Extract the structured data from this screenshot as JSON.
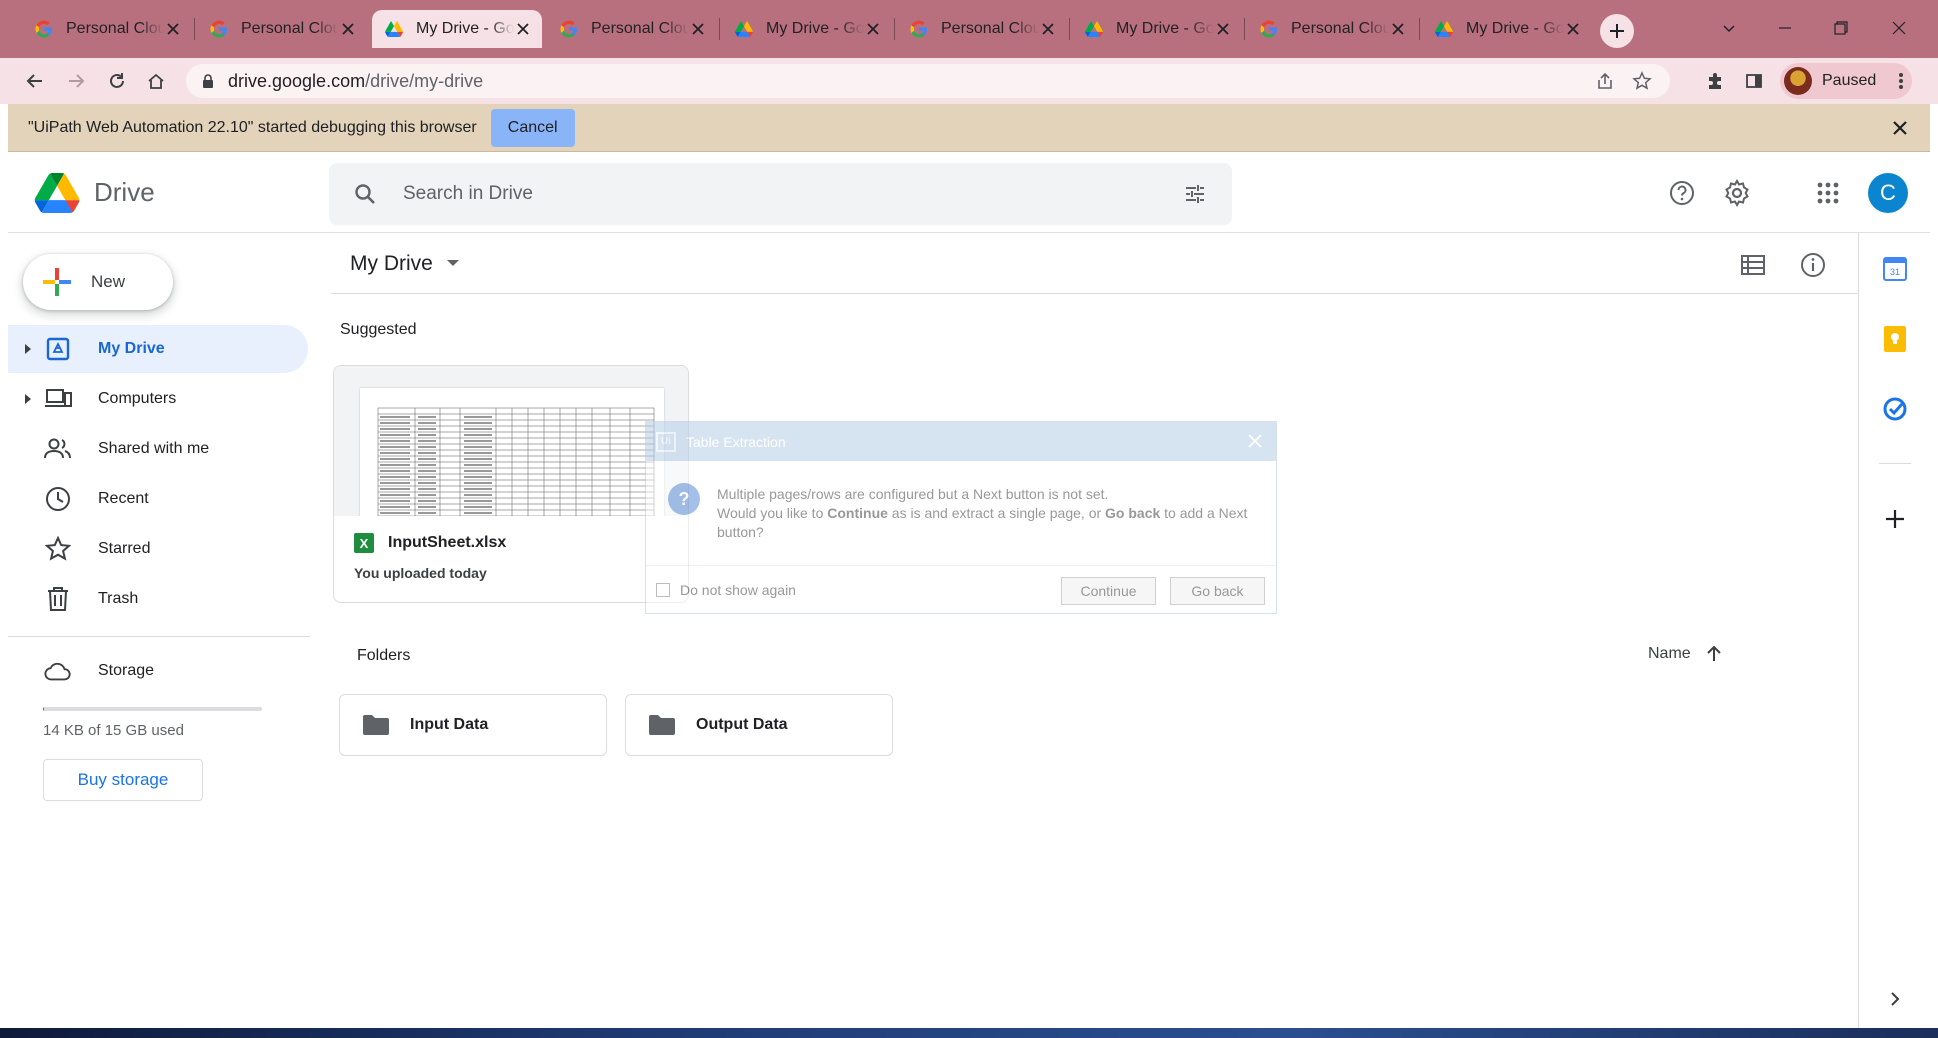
{
  "browser": {
    "tabs": [
      {
        "title": "Personal Cloud",
        "favicon": "google-icon"
      },
      {
        "title": "Personal Cloud",
        "favicon": "google-icon"
      },
      {
        "title": "My Drive - Goo",
        "favicon": "drive-icon"
      },
      {
        "title": "Personal Cloud",
        "favicon": "google-icon"
      },
      {
        "title": "My Drive - Goo",
        "favicon": "drive-icon"
      },
      {
        "title": "Personal Cloud",
        "favicon": "google-icon"
      },
      {
        "title": "My Drive - Goo",
        "favicon": "drive-icon"
      },
      {
        "title": "Personal Cloud",
        "favicon": "google-icon"
      },
      {
        "title": "My Drive - Goo",
        "favicon": "drive-icon"
      }
    ],
    "active_tab_index": 2,
    "url_host": "drive.google.com",
    "url_path": "/drive/my-drive",
    "profile_label": "Paused"
  },
  "infobar": {
    "message": "\"UiPath Web Automation 22.10\" started debugging this browser",
    "cancel_label": "Cancel"
  },
  "header": {
    "brand": "Drive",
    "search_placeholder": "Search in Drive",
    "avatar_letter": "C"
  },
  "sidebar": {
    "new_label": "New",
    "items": [
      {
        "label": "My Drive"
      },
      {
        "label": "Computers"
      },
      {
        "label": "Shared with me"
      },
      {
        "label": "Recent"
      },
      {
        "label": "Starred"
      },
      {
        "label": "Trash"
      },
      {
        "label": "Storage"
      }
    ],
    "storage_text": "14 KB of 15 GB used",
    "storage_used_fraction": 0.001,
    "buy_storage_label": "Buy storage"
  },
  "main": {
    "title": "My Drive",
    "suggested_label": "Suggested",
    "suggested_file": {
      "name": "InputSheet.xlsx",
      "subtitle": "You uploaded today",
      "type_badge": "X"
    },
    "folders_label": "Folders",
    "sort_label": "Name",
    "folders": [
      {
        "name": "Input Data"
      },
      {
        "name": "Output Data"
      }
    ]
  },
  "dialog": {
    "logo_text": "Ui",
    "title": "Table Extraction",
    "line1": "Multiple pages/rows are configured but a Next button is not set.",
    "line2_pre": "Would you like to ",
    "line2_b1": "Continue",
    "line2_mid": " as is and extract a single page, or ",
    "line2_b2": "Go back",
    "line2_post": " to add a Next button?",
    "checkbox_label": "Do not show again",
    "continue_label": "Continue",
    "goback_label": "Go back"
  },
  "colors": {
    "accent": "#1a73e8",
    "active_nav_bg": "#e8f0fe",
    "tabstrip": "#b9707e",
    "infobar": "#e2d3ba"
  }
}
